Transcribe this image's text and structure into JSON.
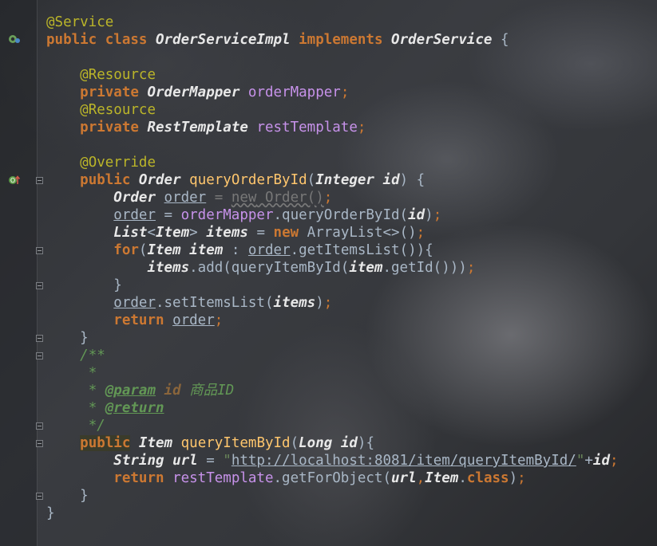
{
  "editor": {
    "lines": [
      [
        {
          "t": "@Service",
          "c": "ann"
        }
      ],
      [
        {
          "t": "public",
          "c": "kw"
        },
        {
          "t": " "
        },
        {
          "t": "class",
          "c": "kw"
        },
        {
          "t": " "
        },
        {
          "t": "OrderServiceImpl",
          "c": "cls"
        },
        {
          "t": " "
        },
        {
          "t": "implements",
          "c": "kw"
        },
        {
          "t": " "
        },
        {
          "t": "OrderService",
          "c": "cls"
        },
        {
          "t": " {"
        }
      ],
      [],
      [
        {
          "t": "    "
        },
        {
          "t": "@Resource",
          "c": "ann"
        }
      ],
      [
        {
          "t": "    "
        },
        {
          "t": "private",
          "c": "kw"
        },
        {
          "t": " "
        },
        {
          "t": "OrderMapper",
          "c": "cls"
        },
        {
          "t": " "
        },
        {
          "t": "orderMapper",
          "c": "fld"
        },
        {
          "t": ";",
          "c": "pun"
        }
      ],
      [
        {
          "t": "    "
        },
        {
          "t": "@Resource",
          "c": "ann"
        }
      ],
      [
        {
          "t": "    "
        },
        {
          "t": "private",
          "c": "kw"
        },
        {
          "t": " "
        },
        {
          "t": "RestTemplate",
          "c": "cls"
        },
        {
          "t": " "
        },
        {
          "t": "restTemplate",
          "c": "fld"
        },
        {
          "t": ";",
          "c": "pun"
        }
      ],
      [],
      [
        {
          "t": "    "
        },
        {
          "t": "@Override",
          "c": "ann"
        }
      ],
      [
        {
          "t": "    "
        },
        {
          "t": "public",
          "c": "kw"
        },
        {
          "t": " "
        },
        {
          "t": "Order",
          "c": "cls"
        },
        {
          "t": " "
        },
        {
          "t": "queryOrderById",
          "c": "mth"
        },
        {
          "t": "("
        },
        {
          "t": "Integer",
          "c": "cls"
        },
        {
          "t": " "
        },
        {
          "t": "id",
          "c": "var"
        },
        {
          "t": ") {"
        }
      ],
      [
        {
          "t": "        "
        },
        {
          "t": "Order",
          "c": "cls"
        },
        {
          "t": " "
        },
        {
          "t": "order",
          "c": "lvar"
        },
        {
          "t": " = ",
          "c": "dim"
        },
        {
          "t": "new",
          "c": "dimu"
        },
        {
          "t": " Order()",
          "c": "dimu"
        },
        {
          "t": ";",
          "c": "pun"
        }
      ],
      [
        {
          "t": "        "
        },
        {
          "t": "order",
          "c": "lvar"
        },
        {
          "t": " = "
        },
        {
          "t": "orderMapper",
          "c": "fld"
        },
        {
          "t": ".queryOrderById("
        },
        {
          "t": "id",
          "c": "var"
        },
        {
          "t": ")"
        },
        {
          "t": ";",
          "c": "pun"
        }
      ],
      [
        {
          "t": "        "
        },
        {
          "t": "List",
          "c": "cls"
        },
        {
          "t": "<"
        },
        {
          "t": "Item",
          "c": "cls"
        },
        {
          "t": "> "
        },
        {
          "t": "items",
          "c": "var"
        },
        {
          "t": " = "
        },
        {
          "t": "new",
          "c": "kw"
        },
        {
          "t": " ArrayList<>()"
        },
        {
          "t": ";",
          "c": "pun"
        }
      ],
      [
        {
          "t": "        "
        },
        {
          "t": "for",
          "c": "kw"
        },
        {
          "t": "("
        },
        {
          "t": "Item",
          "c": "cls"
        },
        {
          "t": " "
        },
        {
          "t": "item",
          "c": "var"
        },
        {
          "t": " : "
        },
        {
          "t": "order",
          "c": "lvar"
        },
        {
          "t": ".getItemsList()){"
        }
      ],
      [
        {
          "t": "            "
        },
        {
          "t": "items",
          "c": "var"
        },
        {
          "t": ".add(queryItemById("
        },
        {
          "t": "item",
          "c": "var"
        },
        {
          "t": ".getId()))"
        },
        {
          "t": ";",
          "c": "pun"
        }
      ],
      [
        {
          "t": "        }"
        }
      ],
      [
        {
          "t": "        "
        },
        {
          "t": "order",
          "c": "lvar"
        },
        {
          "t": ".setItemsList("
        },
        {
          "t": "items",
          "c": "var"
        },
        {
          "t": ")"
        },
        {
          "t": ";",
          "c": "pun"
        }
      ],
      [
        {
          "t": "        "
        },
        {
          "t": "return",
          "c": "kw"
        },
        {
          "t": " "
        },
        {
          "t": "order",
          "c": "lvar"
        },
        {
          "t": ";",
          "c": "pun"
        }
      ],
      [
        {
          "t": "    }"
        }
      ],
      [
        {
          "t": "    "
        },
        {
          "t": "/**",
          "c": "doc"
        }
      ],
      [
        {
          "t": "     "
        },
        {
          "t": "*",
          "c": "doc"
        }
      ],
      [
        {
          "t": "     "
        },
        {
          "t": "* ",
          "c": "doc"
        },
        {
          "t": "@param",
          "c": "doctag"
        },
        {
          "t": " "
        },
        {
          "t": "id",
          "c": "docp"
        },
        {
          "t": " 商品ID",
          "c": "doc"
        }
      ],
      [
        {
          "t": "     "
        },
        {
          "t": "* ",
          "c": "doc"
        },
        {
          "t": "@return",
          "c": "doctag"
        }
      ],
      [
        {
          "t": "     "
        },
        {
          "t": "*/",
          "c": "doc"
        }
      ],
      [
        {
          "t": "    "
        },
        {
          "t": "public",
          "c": "kw hl"
        },
        {
          "t": " "
        },
        {
          "t": "Item",
          "c": "cls"
        },
        {
          "t": " "
        },
        {
          "t": "queryItemById",
          "c": "mth"
        },
        {
          "t": "("
        },
        {
          "t": "Long",
          "c": "cls"
        },
        {
          "t": " "
        },
        {
          "t": "id",
          "c": "var"
        },
        {
          "t": "){"
        }
      ],
      [
        {
          "t": "        "
        },
        {
          "t": "String",
          "c": "cls"
        },
        {
          "t": " "
        },
        {
          "t": "url",
          "c": "var"
        },
        {
          "t": " = "
        },
        {
          "t": "\"",
          "c": "str"
        },
        {
          "t": "http://localhost:8081/item/queryItemById/",
          "c": "url"
        },
        {
          "t": "\"",
          "c": "str"
        },
        {
          "t": "+"
        },
        {
          "t": "id",
          "c": "var"
        },
        {
          "t": ";",
          "c": "pun"
        }
      ],
      [
        {
          "t": "        "
        },
        {
          "t": "return",
          "c": "kw"
        },
        {
          "t": " "
        },
        {
          "t": "restTemplate",
          "c": "fld"
        },
        {
          "t": ".getForObject("
        },
        {
          "t": "url",
          "c": "var"
        },
        {
          "t": ",",
          "c": "pun"
        },
        {
          "t": "Item",
          "c": "cls"
        },
        {
          "t": "."
        },
        {
          "t": "class",
          "c": "kw"
        },
        {
          "t": ")"
        },
        {
          "t": ";",
          "c": "pun"
        }
      ],
      [
        {
          "t": "    }"
        }
      ],
      [
        {
          "t": "}"
        }
      ]
    ]
  },
  "gutter": {
    "class_icon": "spring-bean-icon",
    "override_icon": "override-method-icon"
  }
}
